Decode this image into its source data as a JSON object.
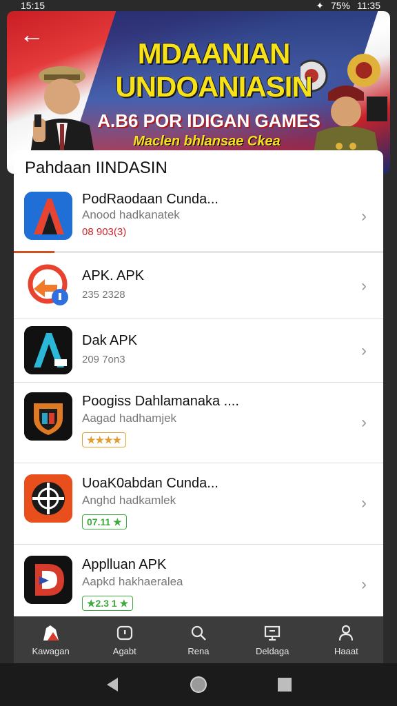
{
  "status_bar": {
    "time": "15:15",
    "battery": "75%",
    "clock_right": "11:35"
  },
  "banner": {
    "title_line1": "MDAANIAN",
    "title_line2": "UNDOANIASIN",
    "subtitle": "A.B6 POR IDIGAN GAMES",
    "tagline": "Maclen bhlansae Ckea"
  },
  "card": {
    "title": "Pahdaan IINDASIN",
    "download_progress": 0.11,
    "apps": [
      {
        "name": "PodRaodaan Cunda...",
        "sub": "Anood hadkanatek",
        "meta": "08 903(3)",
        "meta_color": "#d0252b",
        "icon": "a-logo-icon"
      },
      {
        "name": "APK. APK",
        "sub": "",
        "meta": "235 2328",
        "icon": "refresh-arrow-icon"
      },
      {
        "name": "Dak APK",
        "sub": "",
        "meta": "209 7on3",
        "icon": "a-dark-logo-icon"
      },
      {
        "name": "Poogiss Dahlamanaka ....",
        "sub": "Aagad hadhamjek",
        "badge": "★★★★",
        "badge_color": "orange",
        "icon": "shield-icon"
      },
      {
        "name": "UoaK0abdan Cunda...",
        "sub": "Anghd hadkamlek",
        "badge": "07.11 ★",
        "badge_color": "green",
        "icon": "crosshair-icon"
      },
      {
        "name": "Applluan APK",
        "sub": "Aapkd hakhaeralea",
        "badge": "★2.3 1 ★",
        "badge_color": "green",
        "icon": "d-logo-icon"
      }
    ]
  },
  "tabs": [
    {
      "label": "Kawagan",
      "icon": "home-icon"
    },
    {
      "label": "Agabt",
      "icon": "apps-icon"
    },
    {
      "label": "Rena",
      "icon": "search-icon"
    },
    {
      "label": "Deldaga",
      "icon": "monitor-icon"
    },
    {
      "label": "Haaat",
      "icon": "person-icon"
    }
  ],
  "colors": {
    "accent": "#d0501f",
    "banner_yellow": "#f7e21a",
    "tabbar": "#3c3c3c"
  }
}
